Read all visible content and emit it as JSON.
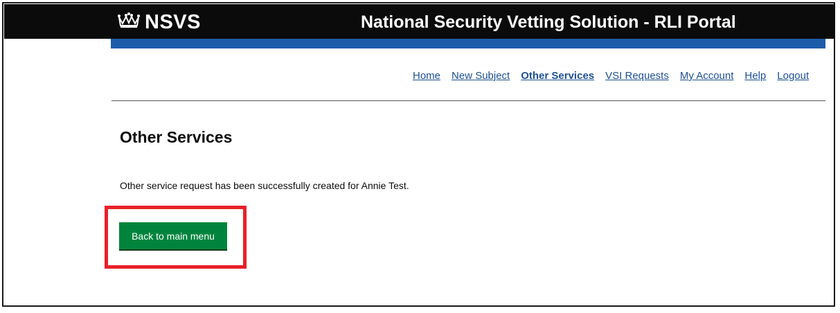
{
  "header": {
    "brand": "NSVS",
    "title": "National Security Vetting Solution - RLI Portal",
    "logo_icon": "crown-icon"
  },
  "colors": {
    "header_bg": "#0b0b0b",
    "accent_bar": "#1d5cab",
    "link": "#1d4f91",
    "button": "#00843d",
    "highlight": "#e8202a"
  },
  "nav": {
    "items": [
      {
        "label": "Home",
        "active": false
      },
      {
        "label": "New Subject",
        "active": false
      },
      {
        "label": "Other Services",
        "active": true
      },
      {
        "label": "VSI Requests",
        "active": false
      },
      {
        "label": "My Account",
        "active": false
      },
      {
        "label": "Help",
        "active": false
      },
      {
        "label": "Logout",
        "active": false
      }
    ]
  },
  "main": {
    "title": "Other Services",
    "message": "Other service request has been successfully created for Annie Test.",
    "back_button_label": "Back to main menu"
  }
}
